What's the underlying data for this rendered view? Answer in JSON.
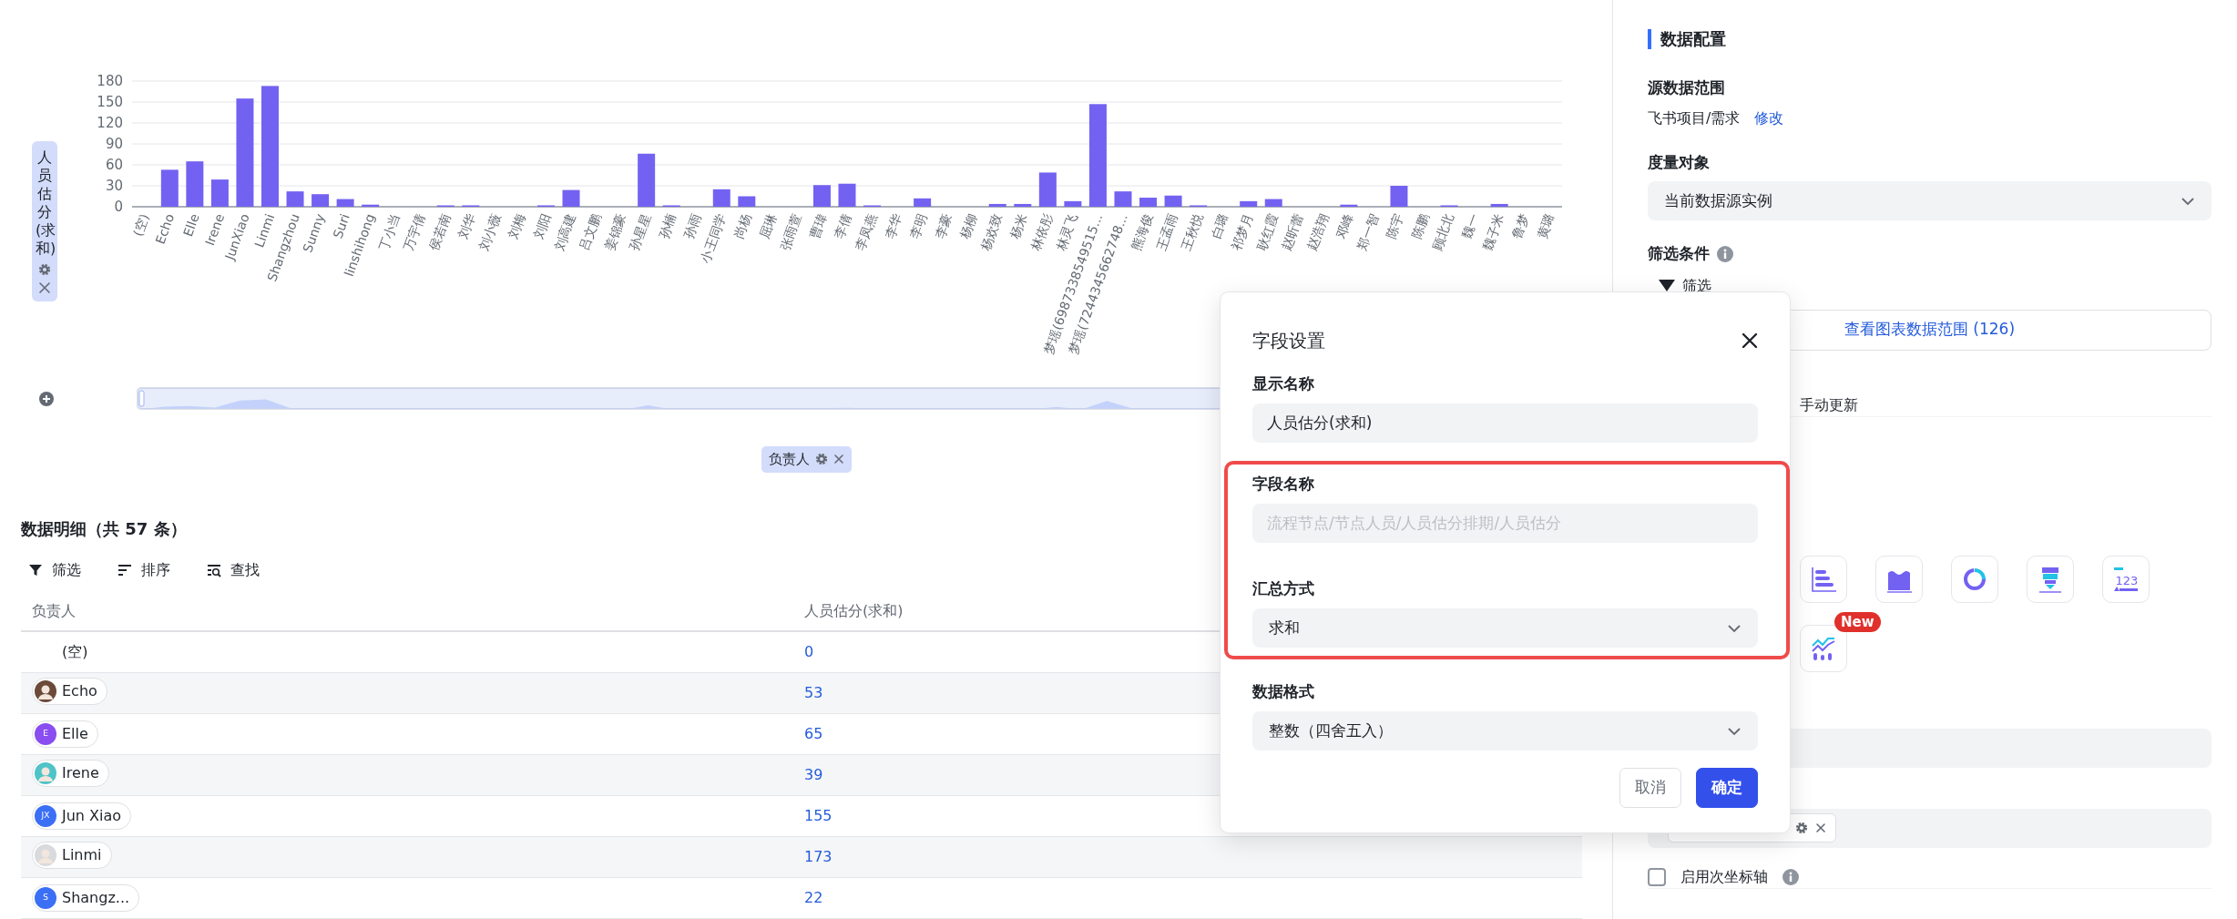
{
  "chart": {
    "y_field": "人员估分(求和)",
    "x_field": "负责人",
    "zoom_window": {
      "level": 1
    },
    "chart_data": {
      "type": "bar",
      "grid": true,
      "ylim": [
        0,
        180
      ],
      "yticks": [
        0,
        30,
        60,
        90,
        120,
        150,
        180
      ],
      "categories": [
        "(空)",
        "Echo",
        "Elle",
        "Irene",
        "JunXiao",
        "Linmi",
        "Shangzhou",
        "Sunny",
        "Suri",
        "linshihong",
        "丁小当",
        "万宇倩",
        "侯若南",
        "刘华",
        "刘小薇",
        "刘梅",
        "刘阳",
        "刘高建",
        "吕文鹏",
        "姜锦豪",
        "孙星星",
        "孙楠",
        "孙雨",
        "小王同学",
        "尚杨",
        "屈琳",
        "张雨萱",
        "曹瑋",
        "李倩",
        "李凤燕",
        "李华",
        "李明",
        "李豪",
        "杨柳",
        "杨欢致",
        "杨米",
        "林依彤",
        "林灵飞",
        "梦瑶(6987338549515...",
        "梦瑶(7244345662748...",
        "熊海俊",
        "王孟雨",
        "王秋悦",
        "白璐",
        "祁梦月",
        "耿红霞",
        "赵昕蕾",
        "赵浩翔",
        "邓峰",
        "郑一智",
        "陈宇",
        "陈鹏",
        "顾北北",
        "魏一",
        "魏子米",
        "鲁梦",
        "黄璐"
      ],
      "values": [
        0,
        53,
        65,
        39,
        155,
        173,
        22,
        18,
        11,
        3,
        0,
        0,
        1,
        2,
        0,
        0,
        2,
        24,
        0,
        0,
        76,
        2,
        0,
        25,
        15,
        0,
        0,
        31,
        33,
        1,
        0,
        12,
        0,
        0,
        4,
        4,
        49,
        8,
        147,
        22,
        13,
        16,
        2,
        0,
        8,
        11,
        0,
        0,
        3,
        0,
        30,
        0,
        2,
        0,
        4,
        0,
        0
      ]
    }
  },
  "table": {
    "title": "数据明细（共 57 条）",
    "toolbar": [
      {
        "kind": "filter",
        "label": "筛选"
      },
      {
        "kind": "sort",
        "label": "排序"
      },
      {
        "kind": "find",
        "label": "查找"
      }
    ],
    "columns": [
      "负责人",
      "人员估分(求和)"
    ],
    "rows": [
      {
        "owner": "(空)",
        "avatar": {
          "kind": "none"
        },
        "value": "0"
      },
      {
        "owner": "Echo",
        "avatar": {
          "kind": "photo",
          "color": "#6b4a3a"
        },
        "value": "53"
      },
      {
        "owner": "Elle",
        "avatar": {
          "kind": "initials",
          "initials": "E",
          "color": "#8a4df0"
        },
        "value": "65"
      },
      {
        "owner": "Irene",
        "avatar": {
          "kind": "photo",
          "color": "#4fc3c8"
        },
        "value": "39"
      },
      {
        "owner": "Jun Xiao",
        "avatar": {
          "kind": "initials",
          "initials": "JX",
          "color": "#3b6ff5"
        },
        "value": "155"
      },
      {
        "owner": "Linmi",
        "avatar": {
          "kind": "photo",
          "color": "#d8dadd"
        },
        "value": "173"
      },
      {
        "owner": "Shangz...",
        "avatar": {
          "kind": "initials",
          "initials": "S",
          "color": "#3b6ff5"
        },
        "value": "22"
      }
    ]
  },
  "config_panel": {
    "title": "数据配置",
    "source_label": "源数据范围",
    "source_value": "飞书项目/需求",
    "source_edit": "修改",
    "measure_label": "度量对象",
    "measure_value": "当前数据源实例",
    "filter_label": "筛选条件",
    "filter_item": "筛选",
    "range_button": "查看图表数据范围 (126)",
    "update_option": "手动更新",
    "chart_types": [
      {
        "kind": "horizontal-bar"
      },
      {
        "kind": "area"
      },
      {
        "kind": "donut"
      },
      {
        "kind": "funnel"
      },
      {
        "kind": "number",
        "glyph": "123"
      },
      {
        "kind": "combo",
        "badge": "New"
      }
    ],
    "secondary_axis": {
      "label": "启用次坐标轴",
      "checked": false
    }
  },
  "dialog": {
    "title": "字段设置",
    "fields": [
      {
        "label": "显示名称",
        "kind": "input",
        "value": "人员估分(求和)",
        "disabled": false,
        "highlighted": false
      },
      {
        "label": "字段名称",
        "kind": "input",
        "value": "流程节点/节点人员/人员估分排期/人员估分",
        "disabled": true,
        "highlighted": true
      },
      {
        "label": "汇总方式",
        "kind": "select",
        "value": "求和",
        "disabled": false,
        "highlighted": true
      },
      {
        "label": "数据格式",
        "kind": "select",
        "value": "整数（四舍五入）",
        "disabled": false,
        "highlighted": false
      }
    ],
    "buttons": [
      {
        "kind": "secondary",
        "label": "取消"
      },
      {
        "kind": "primary",
        "label": "确定"
      }
    ]
  }
}
